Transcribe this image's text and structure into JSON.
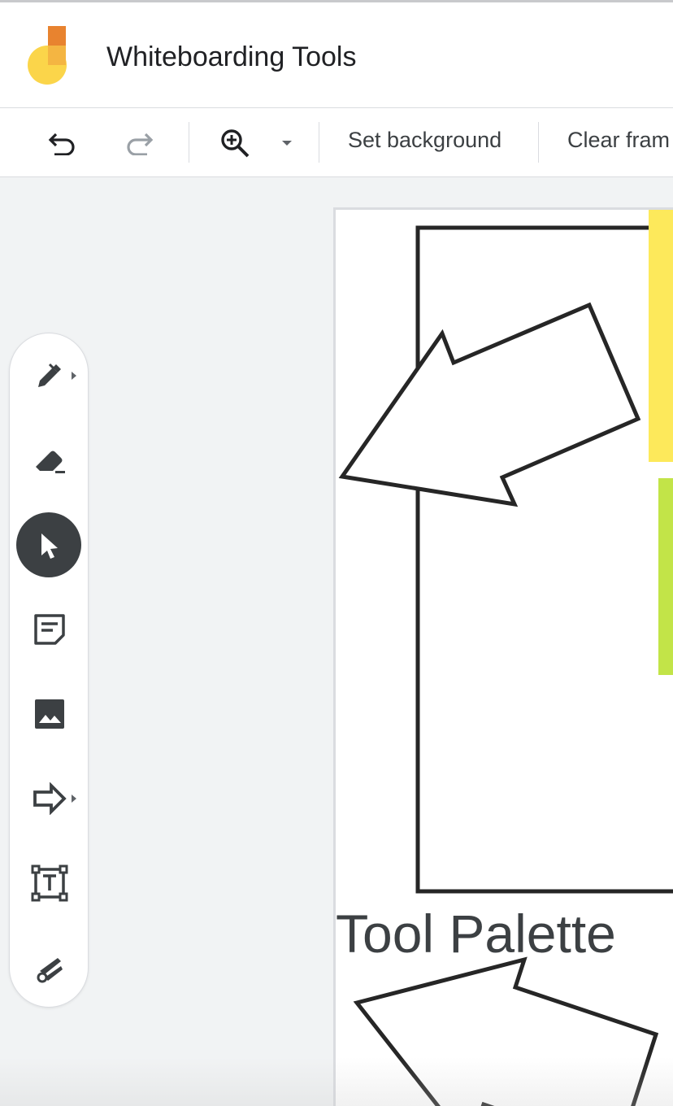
{
  "header": {
    "app_title": "Whiteboarding Tools",
    "logo_colors": [
      "#e8832f",
      "#fbd54a",
      "#f4b542"
    ]
  },
  "toolbar": {
    "undo_icon": "undo-icon",
    "redo_icon": "redo-icon",
    "zoom_icon": "zoom-in-icon",
    "set_background_label": "Set background",
    "clear_frame_label": "Clear fram"
  },
  "canvas": {
    "text_label": "Tool Palette",
    "sticky_colors": [
      "#fde95b",
      "#c2e448"
    ]
  },
  "palette": {
    "tools": [
      {
        "name": "pen",
        "icon": "pen-icon",
        "has_submenu": true
      },
      {
        "name": "eraser",
        "icon": "eraser-icon",
        "has_submenu": false
      },
      {
        "name": "select",
        "icon": "select-arrow-icon",
        "selected": true
      },
      {
        "name": "sticky-note",
        "icon": "sticky-note-icon",
        "has_submenu": false
      },
      {
        "name": "image",
        "icon": "image-icon",
        "has_submenu": false
      },
      {
        "name": "shape",
        "icon": "shape-arrow-icon",
        "has_submenu": true
      },
      {
        "name": "text-box",
        "icon": "text-box-icon",
        "has_submenu": false
      },
      {
        "name": "laser",
        "icon": "laser-icon",
        "has_submenu": false
      }
    ]
  },
  "colors": {
    "accent_dark": "#3c4043",
    "background": "#f1f3f4"
  }
}
